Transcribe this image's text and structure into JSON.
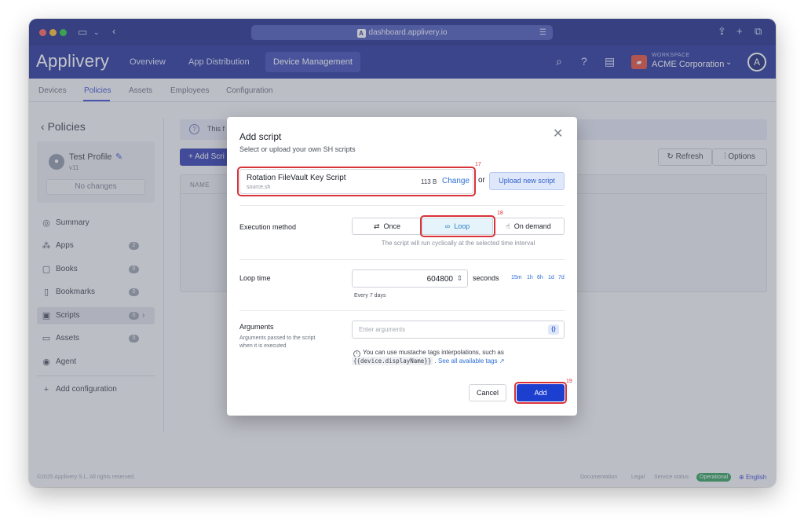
{
  "browser": {
    "url": "dashboard.applivery.io",
    "favicon_glyph": "A"
  },
  "app": {
    "logo": "Applivery",
    "nav": [
      {
        "label": "Overview"
      },
      {
        "label": "App Distribution"
      },
      {
        "label": "Device Management",
        "active": true
      }
    ],
    "workspace_label": "WORKSPACE",
    "workspace_name": "ACME Corporation",
    "avatar_glyph": "A"
  },
  "subtabs": [
    {
      "label": "Devices"
    },
    {
      "label": "Policies",
      "active": true
    },
    {
      "label": "Assets"
    },
    {
      "label": "Employees"
    },
    {
      "label": "Configuration"
    }
  ],
  "sidebar": {
    "title": "Policies",
    "profile": {
      "name": "Test Profile",
      "version": "v11",
      "changes": "No changes"
    },
    "items": [
      {
        "label": "Summary",
        "icon": "check-circle-icon"
      },
      {
        "label": "Apps",
        "badge": "2",
        "icon": "apps-icon"
      },
      {
        "label": "Books",
        "badge": "0",
        "icon": "book-icon"
      },
      {
        "label": "Bookmarks",
        "badge": "0",
        "icon": "bookmark-icon"
      },
      {
        "label": "Scripts",
        "badge": "0",
        "icon": "terminal-icon",
        "active": true
      },
      {
        "label": "Assets",
        "badge": "0",
        "icon": "archive-icon"
      },
      {
        "label": "Agent",
        "icon": "broadcast-icon"
      }
    ],
    "add_configuration": "Add configuration"
  },
  "main": {
    "info_text": "This f",
    "add_script_btn": "+ Add Scri",
    "refresh_btn": "Refresh",
    "options_btn": "Options",
    "table_header_name": "NAME"
  },
  "footer": {
    "copyright": "©2025 Applivery S.L. All rights reserved.",
    "documentation": "Documentation",
    "legal": "Legal",
    "service_status": "Service status",
    "status_value": "Operational",
    "language": "English"
  },
  "modal": {
    "title": "Add script",
    "subtitle": "Select or upload your own SH scripts",
    "script": {
      "name": "Rotation FileVault Key Script",
      "filename": "source.sh",
      "size": "113 B",
      "change_label": "Change"
    },
    "or_label": "or",
    "upload_label": "Upload new script",
    "execution": {
      "label": "Execution method",
      "options": [
        "Once",
        "Loop",
        "On demand"
      ],
      "selected": "Loop",
      "hint": "The script will run cyclically at the selected time interval"
    },
    "loop_time": {
      "label": "Loop time",
      "value": "604800",
      "unit": "seconds",
      "quick": [
        "15m",
        "1h",
        "6h",
        "1d",
        "7d"
      ],
      "hint": "Every 7 days"
    },
    "arguments": {
      "label": "Arguments",
      "description": "Arguments passed to the script when it is executed",
      "placeholder": "Enter arguments",
      "help_prefix": "You can use mustache tags interpolations, such as",
      "example_tag": "{{device.displayName}}",
      "see_all": "See all available tags"
    },
    "cancel_label": "Cancel",
    "add_label": "Add"
  },
  "annotations": {
    "script_box": "17",
    "loop_option": "18",
    "add_button": "19"
  },
  "colors": {
    "primary": "#1d3fd0",
    "header": "#26339a",
    "highlight": "#d9323a",
    "status_ok": "#2f9e5a"
  }
}
